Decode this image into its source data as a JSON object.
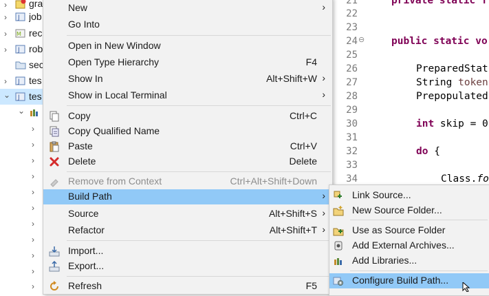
{
  "tree": {
    "items": [
      {
        "label": "gra",
        "chevron": "›"
      },
      {
        "label": "job",
        "chevron": "›"
      },
      {
        "label": "rec",
        "chevron": "›"
      },
      {
        "label": "rob",
        "chevron": "›"
      },
      {
        "label": "sec",
        "chevron": ""
      },
      {
        "label": "tes",
        "chevron": "›"
      },
      {
        "label": "tes",
        "chevron": "⌄"
      }
    ],
    "child_chevrons": [
      "⌄",
      "›",
      "›",
      "›",
      "›",
      "›",
      "›",
      "›",
      "›",
      "›",
      "›",
      "›"
    ]
  },
  "editor": {
    "lines": [
      {
        "n": "21",
        "code_kw": "private static f",
        "code": ""
      },
      {
        "n": "22",
        "code": ""
      },
      {
        "n": "23",
        "code": ""
      },
      {
        "n": "24",
        "marker": "⊖",
        "code_kw": "public static vo",
        "code": ""
      },
      {
        "n": "25",
        "code": ""
      },
      {
        "n": "26",
        "code": "PreparedStat"
      },
      {
        "n": "27",
        "code": "String ",
        "code_var": "token"
      },
      {
        "n": "28",
        "code": "Prepopulated"
      },
      {
        "n": "29",
        "code": ""
      },
      {
        "n": "30",
        "code_kw": "int",
        "code": " skip = 0"
      },
      {
        "n": "31",
        "code": ""
      },
      {
        "n": "32",
        "code_kw": "do",
        "code": " {"
      },
      {
        "n": "33",
        "code": ""
      },
      {
        "n": "34",
        "code": "Class.",
        "code_ital": "fo"
      }
    ]
  },
  "menu": {
    "items": [
      {
        "label": "New",
        "shortcut": "",
        "arrow": "›"
      },
      {
        "label": "Go Into",
        "shortcut": ""
      },
      {
        "label": "Open in New Window",
        "shortcut": ""
      },
      {
        "label": "Open Type Hierarchy",
        "shortcut": "F4"
      },
      {
        "label": "Show In",
        "shortcut": "Alt+Shift+W",
        "arrow": "›"
      },
      {
        "label": "Show in Local Terminal",
        "shortcut": "",
        "arrow": "›"
      },
      {
        "label": "Copy",
        "shortcut": "Ctrl+C",
        "icon": "copy-icon"
      },
      {
        "label": "Copy Qualified Name",
        "shortcut": "",
        "icon": "copy-qualified-name-icon"
      },
      {
        "label": "Paste",
        "shortcut": "Ctrl+V",
        "icon": "paste-icon"
      },
      {
        "label": "Delete",
        "shortcut": "Delete",
        "icon": "delete-icon"
      },
      {
        "label": "Remove from Context",
        "shortcut": "Ctrl+Alt+Shift+Down",
        "icon": "remove-context-icon",
        "disabled": true
      },
      {
        "label": "Build Path",
        "shortcut": "",
        "arrow": "›",
        "highlighted": true
      },
      {
        "label": "Source",
        "shortcut": "Alt+Shift+S",
        "arrow": "›"
      },
      {
        "label": "Refactor",
        "shortcut": "Alt+Shift+T",
        "arrow": "›"
      },
      {
        "label": "Import...",
        "shortcut": "",
        "icon": "import-icon"
      },
      {
        "label": "Export...",
        "shortcut": "",
        "icon": "export-icon"
      },
      {
        "label": "Refresh",
        "shortcut": "F5",
        "icon": "refresh-icon"
      }
    ]
  },
  "submenu": {
    "items": [
      {
        "label": "Link Source...",
        "icon": "link-source-icon"
      },
      {
        "label": "New Source Folder...",
        "icon": "new-source-folder-icon"
      },
      {
        "label": "Use as Source Folder",
        "icon": "use-as-source-folder-icon"
      },
      {
        "label": "Add External Archives...",
        "icon": "jar-icon"
      },
      {
        "label": "Add Libraries...",
        "icon": "library-icon"
      },
      {
        "label": "Configure Build Path...",
        "icon": "configure-build-path-icon",
        "highlighted": true
      }
    ]
  },
  "colors": {
    "menu_bg": "#f2f2f2",
    "highlight": "#91c9f7",
    "keyword": "#7f0055",
    "line_number": "#7a7a7a"
  }
}
